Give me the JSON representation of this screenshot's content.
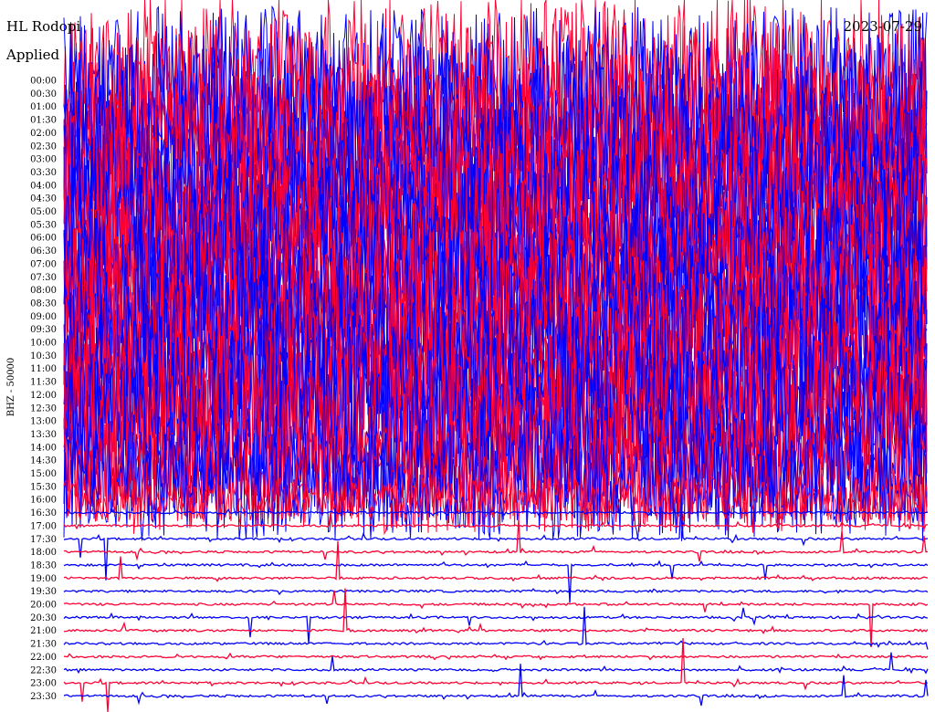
{
  "header": {
    "station": "HL Rodopi",
    "filter": "Applied",
    "date": "2023-07-29"
  },
  "colors": {
    "blue": "#0000ff",
    "red": "#ff0033",
    "background": "#ffffff",
    "text": "#000000"
  },
  "chart_data": {
    "type": "line",
    "subtype": "helicorder",
    "ylabel": "BHZ - 50000",
    "tick_labels": [
      "00:00",
      "00:30",
      "01:00",
      "01:30",
      "02:00",
      "02:30",
      "03:00",
      "03:30",
      "04:00",
      "04:30",
      "05:00",
      "05:30",
      "06:00",
      "06:30",
      "07:00",
      "07:30",
      "08:00",
      "08:30",
      "09:00",
      "09:30",
      "10:00",
      "10:30",
      "11:00",
      "11:30",
      "12:00",
      "12:30",
      "13:00",
      "13:30",
      "14:00",
      "14:30",
      "15:00",
      "15:30",
      "16:00",
      "16:30",
      "17:00",
      "17:30",
      "18:00",
      "18:30",
      "19:00",
      "19:30",
      "20:00",
      "20:30",
      "21:00",
      "21:30",
      "22:00",
      "22:30",
      "23:00",
      "23:30"
    ],
    "trace_colors_alternate": [
      "red",
      "blue"
    ],
    "minutes_per_line": 30,
    "activity": "high-amplitude saturated noise 00:00-15:00, decreasing through 16:00, quiet traces from 16:30 onward with occasional spikes",
    "grid": false,
    "legend": "none"
  }
}
